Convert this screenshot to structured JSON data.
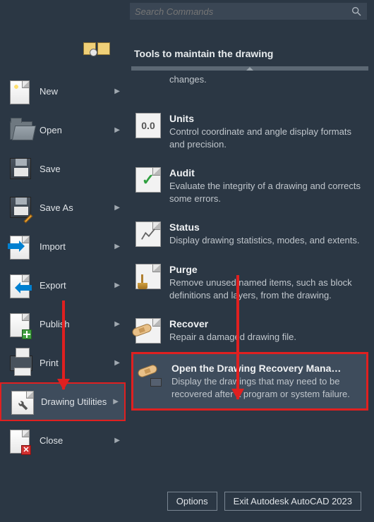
{
  "search": {
    "placeholder": "Search Commands"
  },
  "sidebar": {
    "items": [
      {
        "label": "New",
        "has_arrow": true
      },
      {
        "label": "Open",
        "has_arrow": true
      },
      {
        "label": "Save",
        "has_arrow": false
      },
      {
        "label": "Save As",
        "has_arrow": true
      },
      {
        "label": "Import",
        "has_arrow": true
      },
      {
        "label": "Export",
        "has_arrow": true
      },
      {
        "label": "Publish",
        "has_arrow": true
      },
      {
        "label": "Print",
        "has_arrow": true
      },
      {
        "label": "Drawing Utilities",
        "has_arrow": true
      },
      {
        "label": "Close",
        "has_arrow": true
      }
    ]
  },
  "panel": {
    "title": "Tools to maintain the drawing",
    "items": [
      {
        "title": "",
        "desc": "changes."
      },
      {
        "title": "Units",
        "desc": "Control coordinate and angle display formats and precision."
      },
      {
        "title": "Audit",
        "desc": "Evaluate the integrity of a drawing and corrects some errors."
      },
      {
        "title": "Status",
        "desc": "Display drawing statistics, modes, and extents."
      },
      {
        "title": "Purge",
        "desc": "Remove unused named items, such as block definitions and layers, from the drawing."
      },
      {
        "title": "Recover",
        "desc": "Repair a damaged drawing file."
      },
      {
        "title": "Open the Drawing Recovery Mana…",
        "desc": "Display the drawings that may need to be recovered after a program or system failure."
      }
    ],
    "units_icon_text": "0.0"
  },
  "footer": {
    "options": "Options",
    "exit": "Exit Autodesk AutoCAD 2023"
  }
}
